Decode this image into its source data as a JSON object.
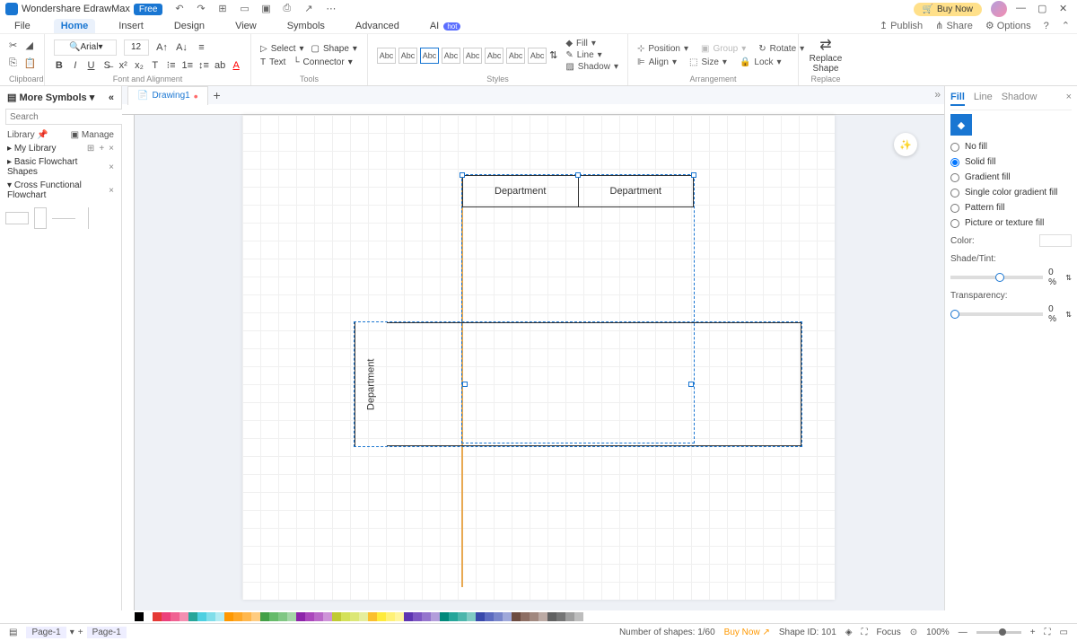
{
  "app": {
    "name": "Wondershare EdrawMax",
    "badge": "Free"
  },
  "buy": "Buy Now",
  "menu": {
    "items": [
      "File",
      "Home",
      "Insert",
      "Design",
      "View",
      "Symbols",
      "Advanced",
      "AI"
    ],
    "active": 1,
    "hot": "hot"
  },
  "top_right": {
    "publish": "Publish",
    "share": "Share",
    "options": "Options"
  },
  "ribbon": {
    "clipboard": "Clipboard",
    "font_align": "Font and Alignment",
    "tools": "Tools",
    "styles": "Styles",
    "arrangement": "Arrangement",
    "replace": "Replace",
    "font": "Arial",
    "size": "12",
    "select": "Select",
    "shape": "Shape",
    "text": "Text",
    "connector": "Connector",
    "fill": "Fill",
    "line": "Line",
    "shadow": "Shadow",
    "position": "Position",
    "group": "Group",
    "rotate": "Rotate",
    "align": "Align",
    "sizeb": "Size",
    "lock": "Lock",
    "replace_shape": "Replace\nShape",
    "abc": "Abc"
  },
  "left": {
    "more": "More Symbols",
    "search_ph": "Search",
    "search_btn": "Search",
    "library": "Library",
    "manage": "Manage",
    "mylib": "My Library",
    "basic": "Basic Flowchart Shapes",
    "cross": "Cross Functional Flowchart"
  },
  "tabs": {
    "drawing": "Drawing1"
  },
  "canvas": {
    "dept1": "Department",
    "dept2": "Department",
    "dept3": "Department"
  },
  "right": {
    "tabs": [
      "Fill",
      "Line",
      "Shadow"
    ],
    "nofill": "No fill",
    "solid": "Solid fill",
    "gradient": "Gradient fill",
    "single": "Single color gradient fill",
    "pattern": "Pattern fill",
    "picture": "Picture or texture fill",
    "color": "Color:",
    "shade": "Shade/Tint:",
    "trans": "Transparency:",
    "zeropct": "0 %"
  },
  "status": {
    "page1": "Page-1",
    "page1b": "Page-1",
    "shapes": "Number of shapes: 1/60",
    "buy": "Buy Now",
    "shapeid": "Shape ID: 101",
    "focus": "Focus",
    "zoom": "100%"
  },
  "colors": [
    "#000",
    "#fff",
    "#e53935",
    "#ec407a",
    "#f06292",
    "#f48fb1",
    "#26a69a",
    "#4dd0e1",
    "#80deea",
    "#b2ebf2",
    "#ff9800",
    "#ffa726",
    "#ffb74d",
    "#ffcc80",
    "#43a047",
    "#66bb6a",
    "#81c784",
    "#a5d6a7",
    "#8e24aa",
    "#ab47bc",
    "#ba68c8",
    "#ce93d8",
    "#c0ca33",
    "#d4e157",
    "#dce775",
    "#e6ee9c",
    "#fbc02d",
    "#ffeb3b",
    "#fff176",
    "#fff59d",
    "#5e35b1",
    "#7e57c2",
    "#9575cd",
    "#b39ddb",
    "#00897b",
    "#26a69a",
    "#4db6ac",
    "#80cbc4",
    "#3949ab",
    "#5c6bc0",
    "#7986cb",
    "#9fa8da",
    "#6d4c41",
    "#8d6e63",
    "#a1887f",
    "#bcaaa4",
    "#616161",
    "#757575",
    "#9e9e9e",
    "#bdbdbd"
  ]
}
